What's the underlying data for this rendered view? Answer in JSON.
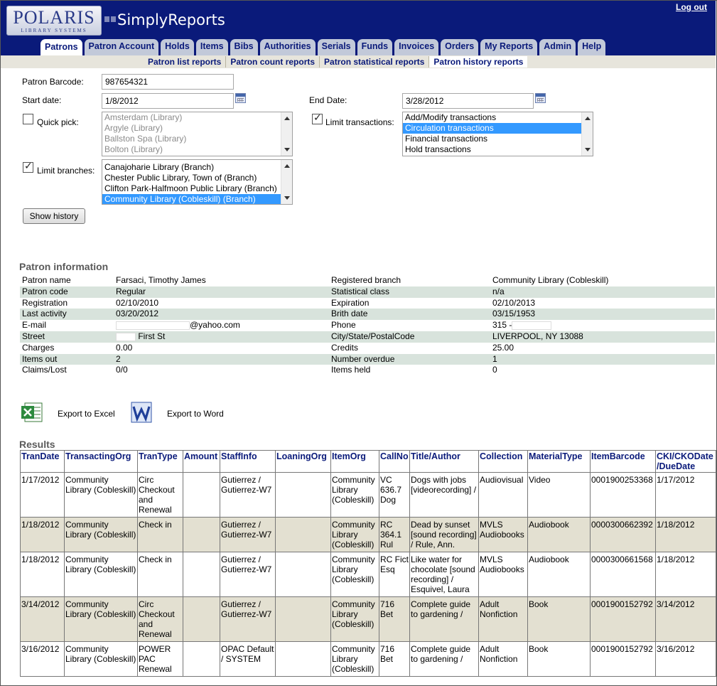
{
  "header": {
    "logo_text": "POLARIS",
    "logo_tagline": "LIBRARY SYSTEMS",
    "app_title": "SimplyReports",
    "logout_label": "Log out",
    "tabs": [
      "Patrons",
      "Patron Account",
      "Holds",
      "Items",
      "Bibs",
      "Authorities",
      "Serials",
      "Funds",
      "Invoices",
      "Orders",
      "My Reports",
      "Admin",
      "Help"
    ],
    "active_tab": "Patrons"
  },
  "subnav": {
    "items": [
      "Patron list reports",
      "Patron count reports",
      "Patron statistical reports",
      "Patron history reports"
    ],
    "active": "Patron history reports"
  },
  "form": {
    "barcode_label": "Patron Barcode:",
    "barcode_value": "987654321",
    "start_label": "Start date:",
    "start_value": "1/8/2012",
    "end_label": "End Date:",
    "end_value": "3/28/2012",
    "quick_pick_label": "Quick pick:",
    "quick_pick_checked": false,
    "quick_pick_options": [
      "Amsterdam (Library)",
      "Argyle (Library)",
      "Ballston Spa (Library)",
      "Bolton (Library)"
    ],
    "limit_transactions_label": "Limit transactions:",
    "limit_transactions_checked": true,
    "transaction_options": [
      "Add/Modify transactions",
      "Circulation transactions",
      "Financial transactions",
      "Hold transactions"
    ],
    "transaction_selected": "Circulation transactions",
    "limit_branches_label": "Limit branches:",
    "limit_branches_checked": true,
    "branch_options": [
      "Canajoharie Library (Branch)",
      "Chester Public Library, Town of (Branch)",
      "Clifton Park-Halfmoon Public Library (Branch)",
      "Community Library (Cobleskill) (Branch)"
    ],
    "branch_selected": "Community Library (Cobleskill) (Branch)",
    "show_history_label": "Show history"
  },
  "patron": {
    "section_title": "Patron information",
    "rows": [
      {
        "l1": "Patron name",
        "v1": "Farsaci, Timothy James",
        "l2": "Registered branch",
        "v2": "Community Library (Cobleskill)"
      },
      {
        "l1": "Patron code",
        "v1": "Regular",
        "l2": "Statistical class",
        "v2": "n/a"
      },
      {
        "l1": "Registration",
        "v1": "02/10/2010",
        "l2": "Expiration",
        "v2": "02/10/2013"
      },
      {
        "l1": "Last activity",
        "v1": "03/20/2012",
        "l2": "Brith date",
        "v2": "03/15/1953"
      },
      {
        "l1": "E-mail",
        "v1": "@yahoo.com",
        "l2": "Phone",
        "v2": "315 -"
      },
      {
        "l1": "Street",
        "v1": "First St",
        "l2": "City/State/PostalCode",
        "v2": "LIVERPOOL, NY 13088"
      },
      {
        "l1": "Charges",
        "v1": "0.00",
        "l2": "Credits",
        "v2": "25.00"
      },
      {
        "l1": "Items out",
        "v1": "2",
        "l2": "Number overdue",
        "v2": "1"
      },
      {
        "l1": "Claims/Lost",
        "v1": "0/0",
        "l2": "Items held",
        "v2": "0"
      }
    ]
  },
  "export": {
    "excel_label": "Export to Excel",
    "word_label": "Export to Word"
  },
  "results": {
    "section_title": "Results",
    "columns": [
      "TranDate",
      "TransactingOrg",
      "TranType",
      "Amount",
      "StaffInfo",
      "LoaningOrg",
      "ItemOrg",
      "CallNo",
      "Title/Author",
      "Collection",
      "MaterialType",
      "ItemBarcode",
      "CKI/CKODate /DueDate"
    ],
    "rows": [
      [
        "1/17/2012",
        "Community Library (Cobleskill)",
        "Circ Checkout and Renewal",
        "",
        "Gutierrez / Gutierrez-W7",
        "",
        "Community Library (Cobleskill)",
        "VC 636.7 Dog",
        "Dogs with jobs [videorecording] /",
        "Audiovisual",
        "Video",
        "0001900253368",
        "1/17/2012"
      ],
      [
        "1/18/2012",
        "Community Library (Cobleskill)",
        "Check in",
        "",
        "Gutierrez / Gutierrez-W7",
        "",
        "Community Library (Cobleskill)",
        "RC 364.1 Rul",
        "Dead by sunset [sound recording] / Rule, Ann.",
        "MVLS Audiobooks",
        "Audiobook",
        "0000300662392",
        "1/18/2012"
      ],
      [
        "1/18/2012",
        "Community Library (Cobleskill)",
        "Check in",
        "",
        "Gutierrez / Gutierrez-W7",
        "",
        "Community Library (Cobleskill)",
        "RC Fict Esq",
        "Like water for chocolate [sound recording] / Esquivel, Laura",
        "MVLS Audiobooks",
        "Audiobook",
        "0000300661568",
        "1/18/2012"
      ],
      [
        "3/14/2012",
        "Community Library (Cobleskill)",
        "Circ Checkout and Renewal",
        "",
        "Gutierrez / Gutierrez-W7",
        "",
        "Community Library (Cobleskill)",
        "716 Bet",
        "Complete guide to gardening /",
        "Adult Nonfiction",
        "Book",
        "0001900152792",
        "3/14/2012"
      ],
      [
        "3/16/2012",
        "Community Library (Cobleskill)",
        "POWER PAC Renewal",
        "",
        "OPAC Default / SYSTEM",
        "",
        "Community Library (Cobleskill)",
        "716 Bet",
        "Complete guide to gardening /",
        "Adult Nonfiction",
        "Book",
        "0001900152792",
        "3/16/2012"
      ]
    ]
  },
  "colors": {
    "header_bg": "#0a1a7a",
    "tab_bg": "#c2c9d9",
    "subnav_bg": "#e7e5dc",
    "selection": "#3399ff",
    "patron_alt_row": "#d8e3dc",
    "result_alt_row": "#e3e0d1"
  },
  "icons": {
    "excel": "excel-icon",
    "word": "word-icon",
    "calendar": "calendar-icon"
  }
}
